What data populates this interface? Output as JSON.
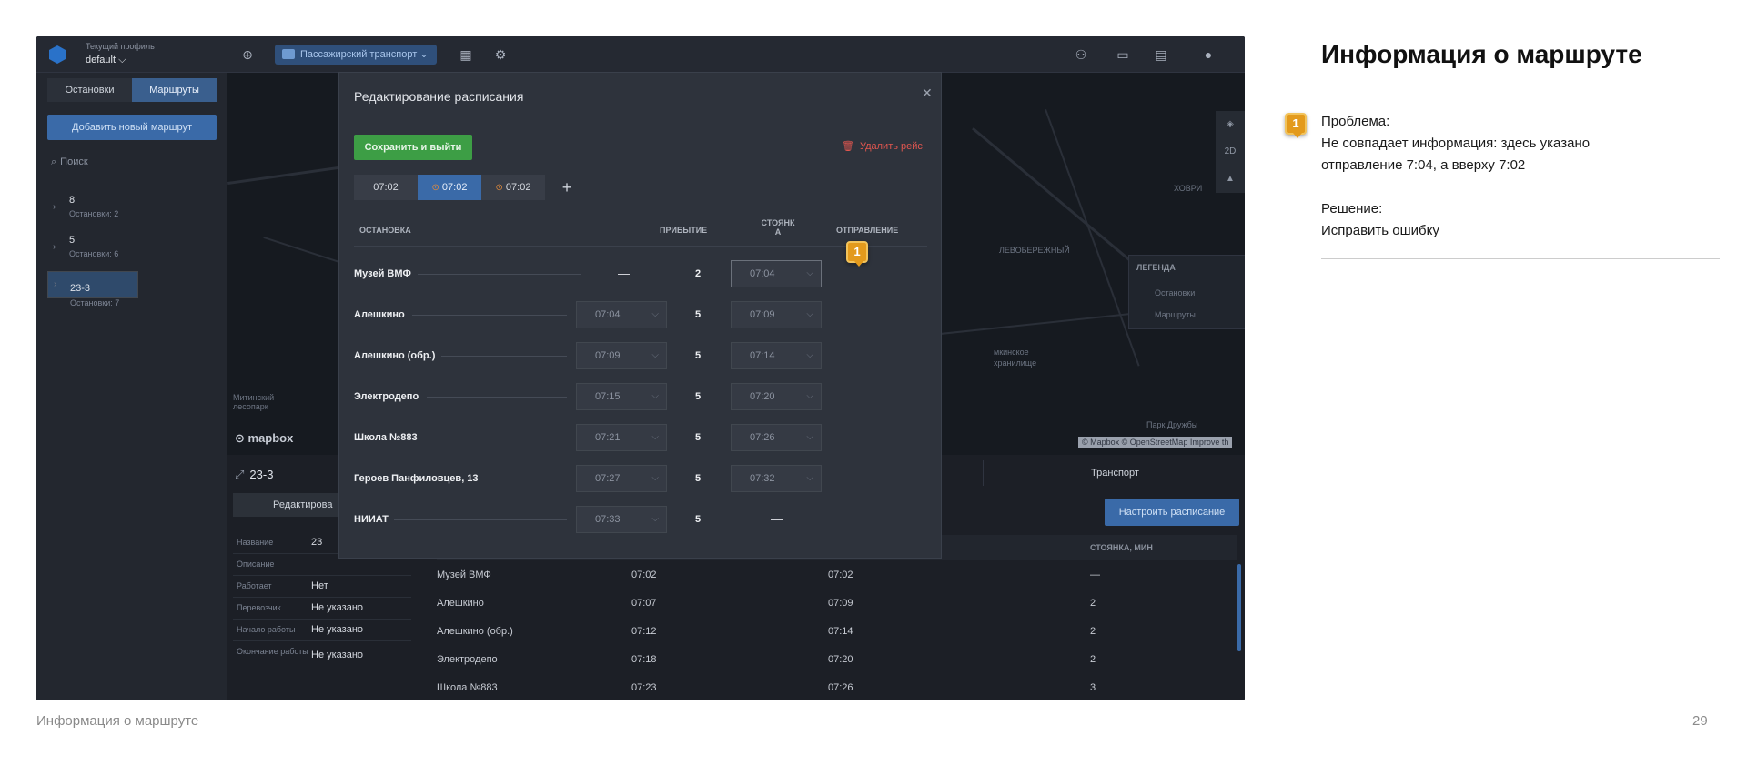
{
  "app": {
    "profile_caption": "Текущий профиль",
    "profile_value": "default ⌵",
    "transport_select": "Пассажирский транспорт ⌄"
  },
  "left": {
    "tabs": [
      {
        "label": "Остановки"
      },
      {
        "label": "Маршруты"
      }
    ],
    "add_button": "Добавить новый маршрут",
    "search_placeholder": "Поиск",
    "routes": [
      {
        "name": "8",
        "stops": "Остановки: 2"
      },
      {
        "name": "5",
        "stops": "Остановки: 6"
      },
      {
        "name": "23-3",
        "stops": "Остановки: 7"
      }
    ]
  },
  "map": {
    "labels": [
      "ХОВРИ",
      "ЛЕВОБЕРЕЖНЫЙ",
      "Митинский лесопарк",
      "Парк Дружбы",
      "мкинское",
      "хранилище"
    ],
    "logo": "mapbox",
    "legend_title": "ЛЕГЕНДА",
    "legend_items": [
      "Остановки",
      "Маршруты"
    ],
    "attribution": "© Mapbox © OpenStreetMap Improve th",
    "ctrl_2d": "2D"
  },
  "bottom": {
    "route_title": "23-3",
    "edit_tab": "Редактирова",
    "info": [
      {
        "k": "Название",
        "v": "23"
      },
      {
        "k": "Описание",
        "v": ""
      },
      {
        "k": "Работает",
        "v": "Нет"
      },
      {
        "k": "Перевозчик",
        "v": "Не указано"
      },
      {
        "k": "Начало работы",
        "v": "Не указано"
      },
      {
        "k": "Окончание работы",
        "v": "Не указано"
      }
    ],
    "transport_tab": "Транспорт",
    "configure_button": "Настроить расписание",
    "parking_header": "СТОЯНКА, МИН",
    "rows": [
      {
        "stop": "Музей ВМФ",
        "arr": "07:02",
        "dep": "07:02",
        "park": "—"
      },
      {
        "stop": "Алешкино",
        "arr": "07:07",
        "dep": "07:09",
        "park": "2"
      },
      {
        "stop": "Алешкино (обр.)",
        "arr": "07:12",
        "dep": "07:14",
        "park": "2"
      },
      {
        "stop": "Электродепо",
        "arr": "07:18",
        "dep": "07:20",
        "park": "2"
      },
      {
        "stop": "Школа №883",
        "arr": "07:23",
        "dep": "07:26",
        "park": "3"
      }
    ]
  },
  "modal": {
    "title": "Редактирование расписания",
    "save_button": "Сохранить и выйти",
    "delete_button": "Удалить рейс",
    "trips": [
      {
        "label": "07:02"
      },
      {
        "label": "07:02"
      },
      {
        "label": "07:02"
      }
    ],
    "headers": {
      "stop": "ОСТАНОВКА",
      "arrival": "ПРИБЫТИЕ",
      "parking_1": "СТОЯНК",
      "parking_2": "А",
      "departure": "ОТПРАВЛЕНИЕ"
    },
    "rows": [
      {
        "stop": "Музей ВМФ",
        "arrival": "—",
        "parking": "2",
        "departure": "07:04"
      },
      {
        "stop": "Алешкино",
        "arrival": "07:04",
        "parking": "5",
        "departure": "07:09"
      },
      {
        "stop": "Алешкино (обр.)",
        "arrival": "07:09",
        "parking": "5",
        "departure": "07:14"
      },
      {
        "stop": "Электродепо",
        "arrival": "07:15",
        "parking": "5",
        "departure": "07:20"
      },
      {
        "stop": "Школа №883",
        "arrival": "07:21",
        "parking": "5",
        "departure": "07:26"
      },
      {
        "stop": "Героев Панфиловцев, 13",
        "arrival": "07:27",
        "parking": "5",
        "departure": "07:32"
      },
      {
        "stop": "НИИАТ",
        "arrival": "07:33",
        "parking": "5",
        "departure": "—"
      }
    ]
  },
  "annotation": {
    "number": "1"
  },
  "right": {
    "title": "Информация о маршруте",
    "problem_label": "Проблема:",
    "problem_text": "Не совпадает информация: здесь указано отправление 7:04, а вверху 7:02",
    "solution_label": "Решение:",
    "solution_text": "Исправить ошибку"
  },
  "footer": {
    "left": "Информация о маршруте",
    "page": "29"
  },
  "colors": {
    "accent": "#3a6aa8",
    "save": "#3d9e45",
    "danger": "#e0564f",
    "badge": "#e39a1c"
  }
}
